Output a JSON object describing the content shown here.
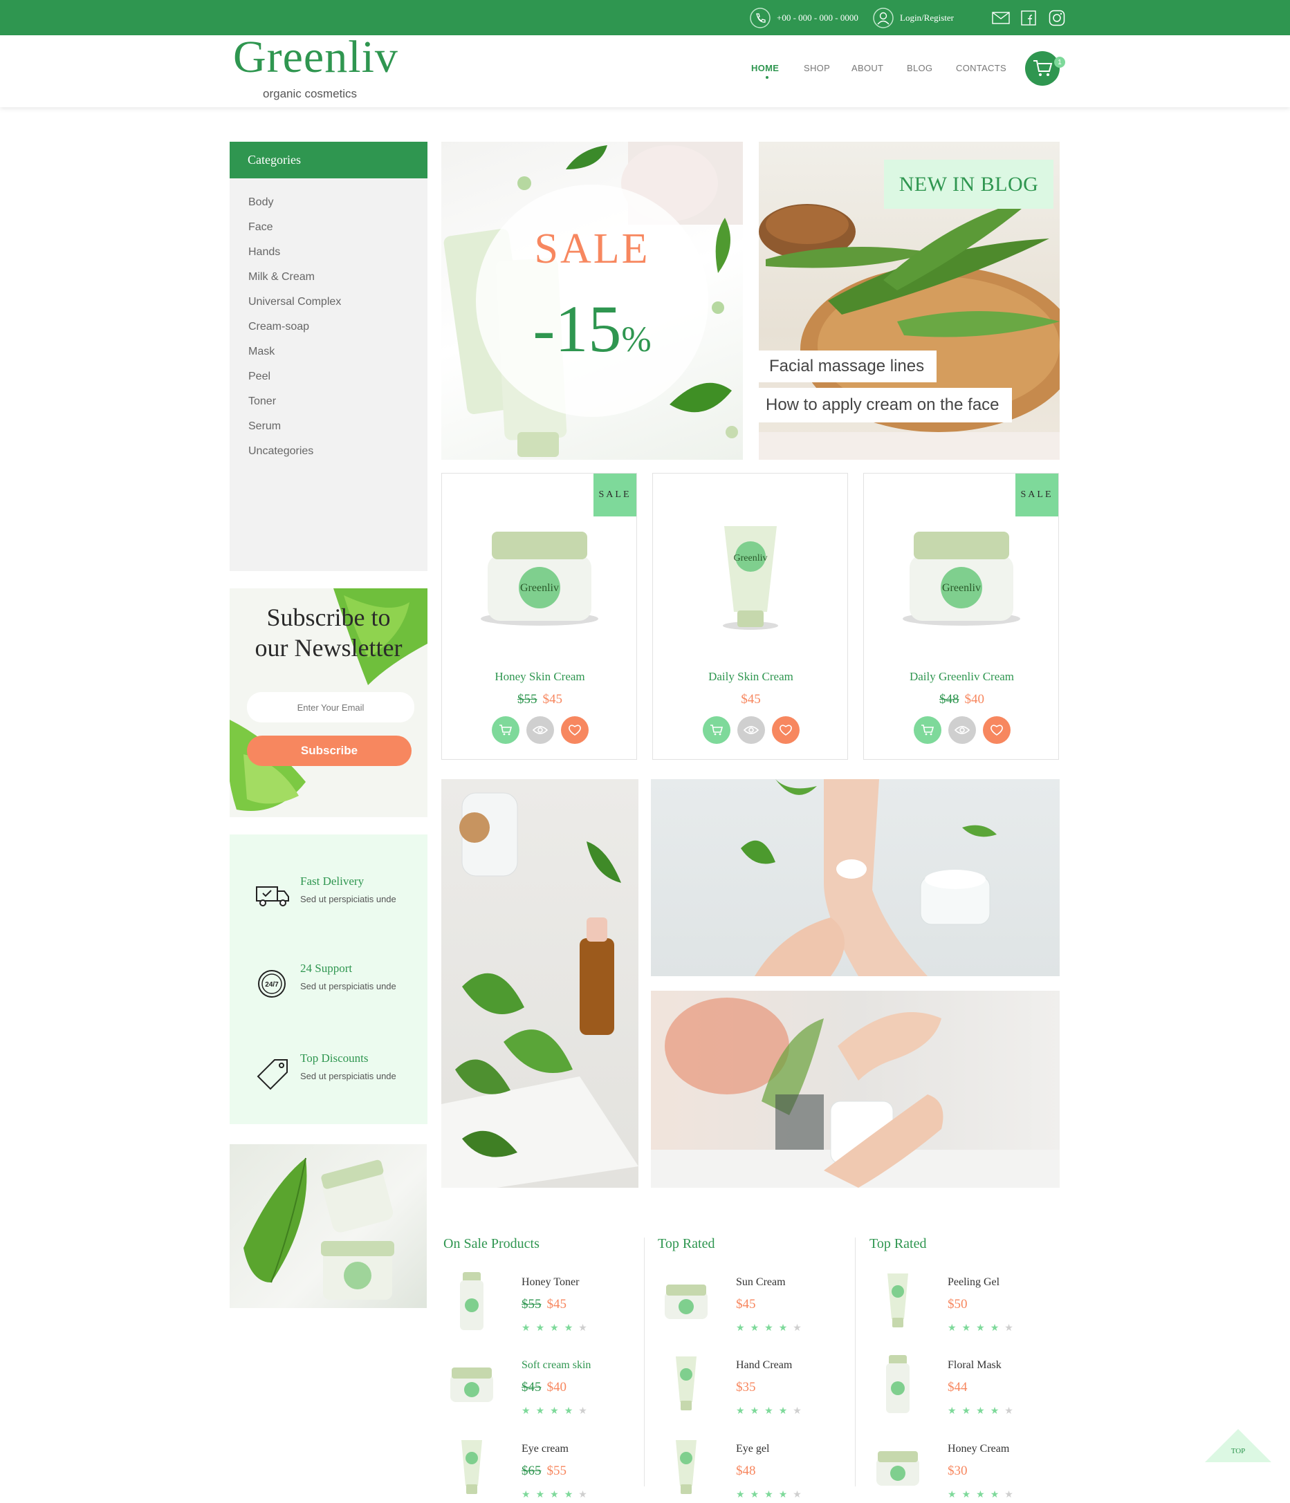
{
  "topbar": {
    "phone": "+00 - 000 - 000 - 0000",
    "login": "Login/Register",
    "icons": [
      "phone-icon",
      "user-icon",
      "mail-icon",
      "facebook-icon",
      "instagram-icon"
    ]
  },
  "header": {
    "logo": "Greenliv",
    "tagline": "organic cosmetics",
    "nav": [
      "HOME",
      "SHOP",
      "ABOUT",
      "BLOG",
      "CONTACTS"
    ],
    "active_nav": "HOME",
    "cart_count": "1"
  },
  "categories": {
    "title": "Categories",
    "items": [
      "Body",
      "Face",
      "Hands",
      "Milk & Cream",
      "Universal Complex",
      "Cream-soap",
      "Mask",
      "Peel",
      "Toner",
      "Serum",
      "Uncategories"
    ]
  },
  "newsletter": {
    "title_line1": "Subscribe to",
    "title_line2": "our Newsletter",
    "placeholder": "Enter Your Email",
    "button": "Subscribe"
  },
  "features": [
    {
      "title": "Fast Delivery",
      "subtitle": "Sed ut perspiciatis unde",
      "icon": "truck-icon"
    },
    {
      "title": "24 Support",
      "subtitle": "Sed ut perspiciatis unde",
      "icon": "support-24-7-icon"
    },
    {
      "title": "Top Discounts",
      "subtitle": "Sed ut perspiciatis unde",
      "icon": "price-tag-icon"
    }
  ],
  "sale_banner": {
    "label": "SALE",
    "percent": "-15",
    "percent_sign": "%"
  },
  "blog_banner": {
    "badge": "NEW IN BLOG",
    "link1": "Facial massage lines",
    "link2": "How to apply cream on the face"
  },
  "products": [
    {
      "name": "Honey Skin Cream",
      "old_price": "$55",
      "price": "$45",
      "badge": "SALE",
      "kind": "jar"
    },
    {
      "name": "Daily Skin Cream",
      "old_price": "",
      "price": "$45",
      "badge": "",
      "kind": "tube"
    },
    {
      "name": "Daily Greenliv Cream",
      "old_price": "$48",
      "price": "$40",
      "badge": "SALE",
      "kind": "jar"
    }
  ],
  "lists": [
    {
      "title": "On Sale Products",
      "items": [
        {
          "name": "Honey  Toner",
          "old_price": "$55",
          "price": "$45",
          "rating": 4,
          "thumb": "bottle",
          "green": false
        },
        {
          "name": "Soft  cream skin",
          "old_price": "$45",
          "price": "$40",
          "rating": 4,
          "thumb": "jar",
          "green": true
        },
        {
          "name": "Eye  cream",
          "old_price": "$65",
          "price": "$55",
          "rating": 4,
          "thumb": "tube",
          "green": false
        }
      ]
    },
    {
      "title": "Top Rated",
      "items": [
        {
          "name": "Sun Cream",
          "old_price": "",
          "price": "$45",
          "rating": 4,
          "thumb": "jar",
          "green": false
        },
        {
          "name": "Hand Cream",
          "old_price": "",
          "price": "$35",
          "rating": 4,
          "thumb": "tube",
          "green": false
        },
        {
          "name": "Eye gel",
          "old_price": "",
          "price": "$48",
          "rating": 4,
          "thumb": "tube",
          "green": false
        }
      ]
    },
    {
      "title": "Top Rated",
      "items": [
        {
          "name": "Peeling Gel",
          "old_price": "",
          "price": "$50",
          "rating": 4,
          "thumb": "tube",
          "green": false
        },
        {
          "name": "Floral Mask",
          "old_price": "",
          "price": "$44",
          "rating": 4,
          "thumb": "bottle",
          "green": false
        },
        {
          "name": "Honey  Cream",
          "old_price": "",
          "price": "$30",
          "rating": 4,
          "thumb": "jar",
          "green": false
        }
      ]
    }
  ],
  "back_to_top": "TOP",
  "colors": {
    "brand_green": "#2f9650",
    "light_green": "#7ed99a",
    "mint": "#ecfbef",
    "accent_orange": "#f7875f"
  }
}
